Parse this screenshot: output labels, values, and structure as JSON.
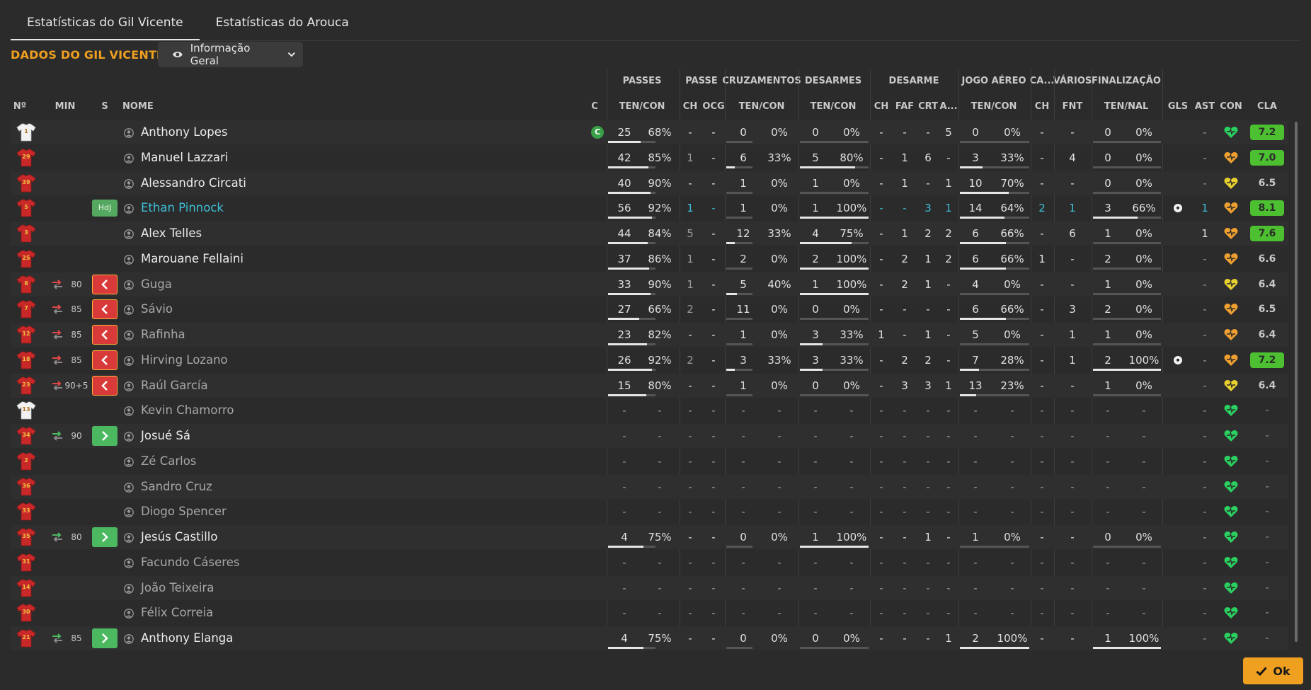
{
  "tabs": [
    {
      "label": "Estatísticas do Gil Vicente",
      "active": true
    },
    {
      "label": "Estatísticas do Arouca",
      "active": false
    }
  ],
  "section_title": "DADOS DO GIL VICENTE",
  "view_select": {
    "selected": "Informação Geral",
    "icon": "eye-icon"
  },
  "group_headers": [
    "PASSES",
    "PASSE",
    "CRUZAMENTOS",
    "DESARMES",
    "DESARME",
    "JOGO AÉREO",
    "CA...",
    "VÁRIOS",
    "FINALIZAÇÃO"
  ],
  "column_headers": {
    "num": "Nº",
    "min": "MIN",
    "s": "S",
    "name": "NOME",
    "c": "C",
    "pass_tencon": "TEN/CON",
    "pass_ch": "CH",
    "pass_ocg": "OCG",
    "cross_tencon": "TEN/CON",
    "tack_tencon": "TEN/CON",
    "des_ch": "CH",
    "des_faf": "FAF",
    "des_crt": "CRT",
    "des_a": "A...",
    "air_tencon": "TEN/CON",
    "ca_ch": "CH",
    "var_fnt": "FNT",
    "fin_tennal": "TEN/NAL",
    "gls": "GLS",
    "ast": "AST",
    "con": "CON",
    "cla": "CLA"
  },
  "players": [
    {
      "shirt": "1",
      "gk": true,
      "min": "",
      "sub": "",
      "hdj": false,
      "name": "Anthony Lopes",
      "captain": true,
      "name_style": "normal",
      "p1": "25",
      "p2": "68%",
      "pf": 0.68,
      "ch": "-",
      "ocg": "-",
      "c1": "0",
      "c2": "0%",
      "cf": 0,
      "t1": "0",
      "t2": "0%",
      "tf": 0,
      "dch": "-",
      "faf": "-",
      "crt": "-",
      "da": "5",
      "a1": "0",
      "a2": "0%",
      "af": 0,
      "cach": "-",
      "fnt": "-",
      "f1": "0",
      "f2": "0%",
      "ff": 0,
      "gls": "",
      "ast": "-",
      "con": "green",
      "cla": "7.2",
      "clas": "g",
      "hl": false
    },
    {
      "shirt": "29",
      "gk": false,
      "min": "",
      "sub": "",
      "hdj": false,
      "name": "Manuel Lazzari",
      "captain": false,
      "name_style": "normal",
      "p1": "42",
      "p2": "85%",
      "pf": 0.85,
      "ch": "1",
      "ocg": "-",
      "c1": "6",
      "c2": "33%",
      "cf": 0.33,
      "t1": "5",
      "t2": "80%",
      "tf": 0.8,
      "dch": "-",
      "faf": "1",
      "crt": "6",
      "da": "-",
      "a1": "3",
      "a2": "33%",
      "af": 0.33,
      "cach": "-",
      "fnt": "4",
      "f1": "0",
      "f2": "0%",
      "ff": 0,
      "gls": "",
      "ast": "-",
      "con": "orange",
      "cla": "7.0",
      "clas": "g",
      "hl": false
    },
    {
      "shirt": "39",
      "gk": false,
      "min": "",
      "sub": "",
      "hdj": false,
      "name": "Alessandro Circati",
      "captain": false,
      "name_style": "normal",
      "p1": "40",
      "p2": "90%",
      "pf": 0.9,
      "ch": "-",
      "ocg": "-",
      "c1": "1",
      "c2": "0%",
      "cf": 0,
      "t1": "1",
      "t2": "0%",
      "tf": 0,
      "dch": "-",
      "faf": "1",
      "crt": "-",
      "da": "1",
      "a1": "10",
      "a2": "70%",
      "af": 0.7,
      "cach": "-",
      "fnt": "-",
      "f1": "0",
      "f2": "0%",
      "ff": 0,
      "gls": "",
      "ast": "-",
      "con": "yellow",
      "cla": "6.5",
      "clas": "n",
      "hl": false
    },
    {
      "shirt": "5",
      "gk": false,
      "min": "",
      "sub": "",
      "hdj": true,
      "hdj_label": "HdJ",
      "name": "Ethan Pinnock",
      "captain": false,
      "name_style": "cyan",
      "p1": "56",
      "p2": "92%",
      "pf": 0.92,
      "ch": "1",
      "ocg": "-",
      "c1": "1",
      "c2": "0%",
      "cf": 0,
      "t1": "1",
      "t2": "100%",
      "tf": 1,
      "dch": "-",
      "faf": "-",
      "crt": "3",
      "da": "1",
      "a1": "14",
      "a2": "64%",
      "af": 0.64,
      "cach": "2",
      "fnt": "1",
      "f1": "3",
      "f2": "66%",
      "ff": 0.66,
      "gls": "ball",
      "ast": "1",
      "con": "orange",
      "cla": "8.1",
      "clas": "g",
      "hl": true
    },
    {
      "shirt": "3",
      "gk": false,
      "min": "",
      "sub": "",
      "hdj": false,
      "name": "Alex Telles",
      "captain": false,
      "name_style": "normal",
      "p1": "44",
      "p2": "84%",
      "pf": 0.84,
      "ch": "5",
      "ocg": "-",
      "c1": "12",
      "c2": "33%",
      "cf": 0.33,
      "t1": "4",
      "t2": "75%",
      "tf": 0.75,
      "dch": "-",
      "faf": "1",
      "crt": "2",
      "da": "2",
      "a1": "6",
      "a2": "66%",
      "af": 0.66,
      "cach": "-",
      "fnt": "6",
      "f1": "1",
      "f2": "0%",
      "ff": 0,
      "gls": "",
      "ast": "1",
      "con": "orange",
      "cla": "7.6",
      "clas": "g",
      "hl": false
    },
    {
      "shirt": "25",
      "gk": false,
      "min": "",
      "sub": "",
      "hdj": false,
      "name": "Marouane Fellaini",
      "captain": false,
      "name_style": "normal",
      "p1": "37",
      "p2": "86%",
      "pf": 0.86,
      "ch": "1",
      "ocg": "-",
      "c1": "2",
      "c2": "0%",
      "cf": 0,
      "t1": "2",
      "t2": "100%",
      "tf": 1,
      "dch": "-",
      "faf": "2",
      "crt": "1",
      "da": "2",
      "a1": "6",
      "a2": "66%",
      "af": 0.66,
      "cach": "1",
      "fnt": "-",
      "f1": "2",
      "f2": "0%",
      "ff": 0,
      "gls": "",
      "ast": "-",
      "con": "orange",
      "cla": "6.6",
      "clas": "n",
      "hl": false
    },
    {
      "shirt": "8",
      "gk": false,
      "min": "80",
      "sub": "off",
      "hdj": false,
      "name": "Guga",
      "captain": false,
      "name_style": "dim",
      "p1": "33",
      "p2": "90%",
      "pf": 0.9,
      "ch": "1",
      "ocg": "-",
      "c1": "5",
      "c2": "40%",
      "cf": 0.4,
      "t1": "1",
      "t2": "100%",
      "tf": 1,
      "dch": "-",
      "faf": "2",
      "crt": "1",
      "da": "-",
      "a1": "4",
      "a2": "0%",
      "af": 0,
      "cach": "-",
      "fnt": "-",
      "f1": "1",
      "f2": "0%",
      "ff": 0,
      "gls": "",
      "ast": "-",
      "con": "yellow",
      "cla": "6.4",
      "clas": "n",
      "hl": false
    },
    {
      "shirt": "7",
      "gk": false,
      "min": "85",
      "sub": "off",
      "hdj": false,
      "name": "Sávio",
      "captain": false,
      "name_style": "dim",
      "p1": "27",
      "p2": "66%",
      "pf": 0.66,
      "ch": "2",
      "ocg": "-",
      "c1": "11",
      "c2": "0%",
      "cf": 0,
      "t1": "0",
      "t2": "0%",
      "tf": 0,
      "dch": "-",
      "faf": "-",
      "crt": "-",
      "da": "-",
      "a1": "6",
      "a2": "66%",
      "af": 0.66,
      "cach": "-",
      "fnt": "3",
      "f1": "2",
      "f2": "0%",
      "ff": 0,
      "gls": "",
      "ast": "-",
      "con": "orange",
      "cla": "6.5",
      "clas": "n",
      "hl": false
    },
    {
      "shirt": "12",
      "gk": false,
      "min": "85",
      "sub": "off",
      "hdj": false,
      "name": "Rafinha",
      "captain": false,
      "name_style": "dim",
      "p1": "23",
      "p2": "82%",
      "pf": 0.82,
      "ch": "-",
      "ocg": "-",
      "c1": "1",
      "c2": "0%",
      "cf": 0,
      "t1": "3",
      "t2": "33%",
      "tf": 0.33,
      "dch": "1",
      "faf": "-",
      "crt": "1",
      "da": "-",
      "a1": "5",
      "a2": "0%",
      "af": 0,
      "cach": "-",
      "fnt": "1",
      "f1": "1",
      "f2": "0%",
      "ff": 0,
      "gls": "",
      "ast": "-",
      "con": "orange",
      "cla": "6.4",
      "clas": "n",
      "hl": false
    },
    {
      "shirt": "18",
      "gk": false,
      "min": "85",
      "sub": "off",
      "hdj": false,
      "name": "Hirving Lozano",
      "captain": false,
      "name_style": "dim",
      "p1": "26",
      "p2": "92%",
      "pf": 0.92,
      "ch": "2",
      "ocg": "-",
      "c1": "3",
      "c2": "33%",
      "cf": 0.33,
      "t1": "3",
      "t2": "33%",
      "tf": 0.33,
      "dch": "-",
      "faf": "2",
      "crt": "2",
      "da": "-",
      "a1": "7",
      "a2": "28%",
      "af": 0.28,
      "cach": "-",
      "fnt": "1",
      "f1": "2",
      "f2": "100%",
      "ff": 1,
      "gls": "ball",
      "ast": "-",
      "con": "orange",
      "cla": "7.2",
      "clas": "g",
      "hl": false
    },
    {
      "shirt": "23",
      "gk": false,
      "min": "90+5",
      "sub": "off",
      "hdj": false,
      "name": "Raúl García",
      "captain": false,
      "name_style": "dim",
      "p1": "15",
      "p2": "80%",
      "pf": 0.8,
      "ch": "-",
      "ocg": "-",
      "c1": "1",
      "c2": "0%",
      "cf": 0,
      "t1": "0",
      "t2": "0%",
      "tf": 0,
      "dch": "-",
      "faf": "3",
      "crt": "3",
      "da": "1",
      "a1": "13",
      "a2": "23%",
      "af": 0.23,
      "cach": "-",
      "fnt": "-",
      "f1": "1",
      "f2": "0%",
      "ff": 0,
      "gls": "",
      "ast": "-",
      "con": "yellow",
      "cla": "6.4",
      "clas": "n",
      "hl": false
    },
    {
      "shirt": "13",
      "gk": true,
      "min": "",
      "sub": "",
      "hdj": false,
      "name": "Kevin Chamorro",
      "captain": false,
      "name_style": "dim",
      "empty": true,
      "con": "green",
      "cla": "-",
      "clas": "dash",
      "ast": "-"
    },
    {
      "shirt": "34",
      "gk": false,
      "min": "90",
      "sub": "on",
      "hdj": false,
      "name": "Josué Sá",
      "captain": false,
      "name_style": "normal",
      "empty": true,
      "con": "green",
      "cla": "-",
      "clas": "dash",
      "ast": "-"
    },
    {
      "shirt": "2",
      "gk": false,
      "min": "",
      "sub": "",
      "hdj": false,
      "name": "Zé Carlos",
      "captain": false,
      "name_style": "dim",
      "empty": true,
      "con": "green",
      "cla": "-",
      "clas": "dash",
      "ast": "-"
    },
    {
      "shirt": "36",
      "gk": false,
      "min": "",
      "sub": "",
      "hdj": false,
      "name": "Sandro Cruz",
      "captain": false,
      "name_style": "dim",
      "empty": true,
      "con": "green",
      "cla": "-",
      "clas": "dash",
      "ast": "-"
    },
    {
      "shirt": "33",
      "gk": false,
      "min": "",
      "sub": "",
      "hdj": false,
      "name": "Diogo Spencer",
      "captain": false,
      "name_style": "dim",
      "empty": true,
      "con": "green",
      "cla": "-",
      "clas": "dash",
      "ast": "-"
    },
    {
      "shirt": "35",
      "gk": false,
      "min": "80",
      "sub": "on",
      "hdj": false,
      "name": "Jesús Castillo",
      "captain": false,
      "name_style": "normal",
      "p1": "4",
      "p2": "75%",
      "pf": 0.75,
      "ch": "-",
      "ocg": "-",
      "c1": "0",
      "c2": "0%",
      "cf": 0,
      "t1": "1",
      "t2": "100%",
      "tf": 1,
      "dch": "-",
      "faf": "-",
      "crt": "1",
      "da": "-",
      "a1": "1",
      "a2": "0%",
      "af": 0,
      "cach": "-",
      "fnt": "-",
      "f1": "0",
      "f2": "0%",
      "ff": 0,
      "gls": "",
      "ast": "-",
      "con": "green",
      "cla": "-",
      "clas": "dash",
      "hl": false
    },
    {
      "shirt": "31",
      "gk": false,
      "min": "",
      "sub": "",
      "hdj": false,
      "name": "Facundo Cáseres",
      "captain": false,
      "name_style": "dim",
      "empty": true,
      "con": "green",
      "cla": "-",
      "clas": "dash",
      "ast": "-"
    },
    {
      "shirt": "14",
      "gk": false,
      "min": "",
      "sub": "",
      "hdj": false,
      "name": "João Teixeira",
      "captain": false,
      "name_style": "dim",
      "empty": true,
      "con": "green",
      "cla": "-",
      "clas": "dash",
      "ast": "-"
    },
    {
      "shirt": "30",
      "gk": false,
      "min": "",
      "sub": "",
      "hdj": false,
      "name": "Félix Correia",
      "captain": false,
      "name_style": "dim",
      "empty": true,
      "con": "green",
      "cla": "-",
      "clas": "dash",
      "ast": "-"
    },
    {
      "shirt": "21",
      "gk": false,
      "min": "85",
      "sub": "on",
      "hdj": false,
      "name": "Anthony Elanga",
      "captain": false,
      "name_style": "normal",
      "p1": "4",
      "p2": "75%",
      "pf": 0.75,
      "ch": "-",
      "ocg": "-",
      "c1": "0",
      "c2": "0%",
      "cf": 0,
      "t1": "0",
      "t2": "0%",
      "tf": 0,
      "dch": "-",
      "faf": "-",
      "crt": "-",
      "da": "1",
      "a1": "2",
      "a2": "100%",
      "af": 1,
      "cach": "-",
      "fnt": "-",
      "f1": "1",
      "f2": "100%",
      "ff": 1,
      "gls": "",
      "ast": "-",
      "con": "green",
      "cla": "-",
      "clas": "dash",
      "hl": false
    }
  ],
  "captain_label": "C",
  "ok_button": {
    "label": "Ok"
  },
  "colors": {
    "accent": "#f0a020",
    "shirt_red": "#c82828",
    "cyan": "#3ec0d8",
    "rating_green": "#4cc030",
    "con_green": "#2ad060",
    "con_orange": "#f0a030",
    "con_yellow": "#e8d030"
  }
}
